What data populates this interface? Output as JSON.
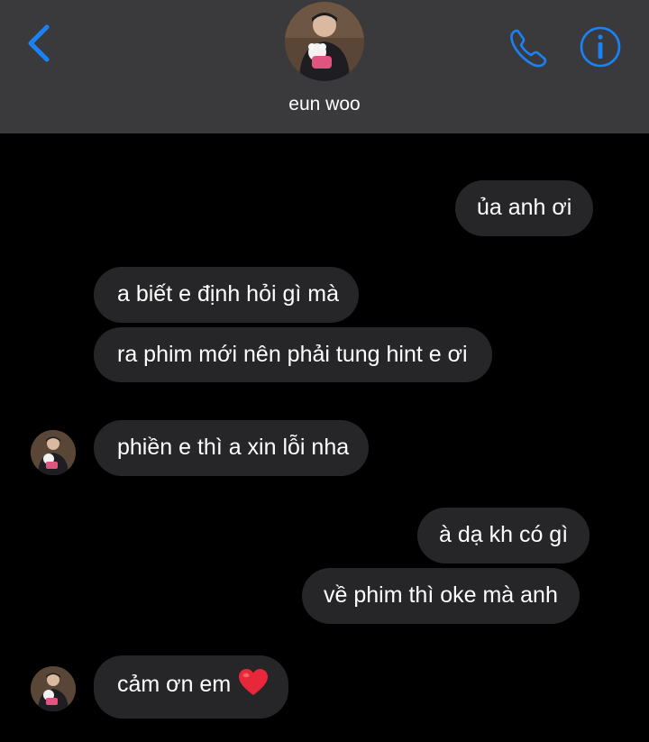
{
  "header": {
    "contact_name": "eun woo",
    "back_icon": "chevron-left-icon",
    "call_icon": "phone-icon",
    "info_icon": "info-icon",
    "accent_color": "#1a82f7",
    "background_color": "#3a3a3c"
  },
  "messages": [
    {
      "side": "outgoing",
      "text": "ủa anh ơi"
    },
    {
      "side": "incoming",
      "text": "a biết e định hỏi gì mà"
    },
    {
      "side": "incoming",
      "text": "ra phim mới nên phải tung hint e ơi"
    },
    {
      "side": "incoming",
      "text": "phiền e thì a xin lỗi nha"
    },
    {
      "side": "outgoing",
      "text": "à dạ kh có gì"
    },
    {
      "side": "outgoing",
      "text": "về phim thì oke mà anh"
    },
    {
      "side": "incoming",
      "text": "cảm ơn em",
      "emoji": "heart-icon"
    }
  ],
  "colors": {
    "bubble": "#262628",
    "text": "#ffffff",
    "background": "#000000"
  }
}
